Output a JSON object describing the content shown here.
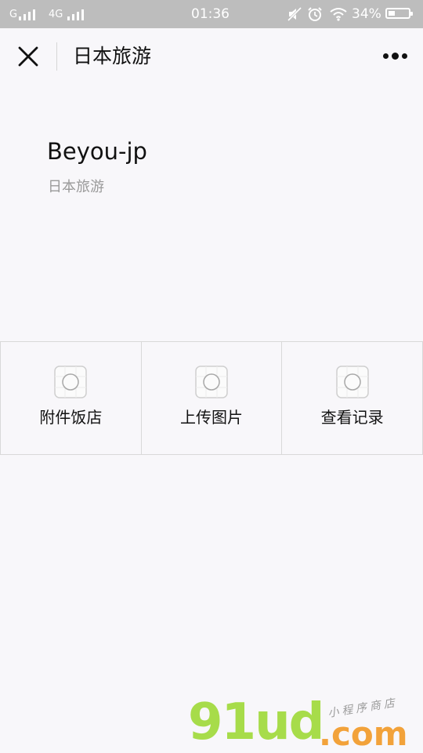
{
  "status_bar": {
    "carrier1": "G",
    "carrier2": "4G",
    "time": "01:36",
    "battery": "34%",
    "battery_level": 0.34,
    "icons": [
      "signal-icon",
      "silent-icon",
      "alarm-icon",
      "wifi-icon",
      "battery-icon"
    ]
  },
  "nav": {
    "title": "日本旅游",
    "icons": [
      "close-icon",
      "more-icon"
    ]
  },
  "app": {
    "name": "Beyou-jp",
    "subtitle": "日本旅游"
  },
  "grid": {
    "items": [
      {
        "label": "附件饭店",
        "icon": "placeholder-icon"
      },
      {
        "label": "上传图片",
        "icon": "placeholder-icon"
      },
      {
        "label": "查看记录",
        "icon": "placeholder-icon"
      }
    ]
  },
  "watermark": {
    "main": "91ud",
    "domain": ".com",
    "tagline": "小程序商店"
  },
  "colors": {
    "statusbar_bg": "#bdbdbd",
    "page_bg": "#f8f7fa",
    "divider": "#d9d9d9",
    "watermark_green": "#a7dc4a",
    "watermark_orange": "#f2a23a"
  }
}
